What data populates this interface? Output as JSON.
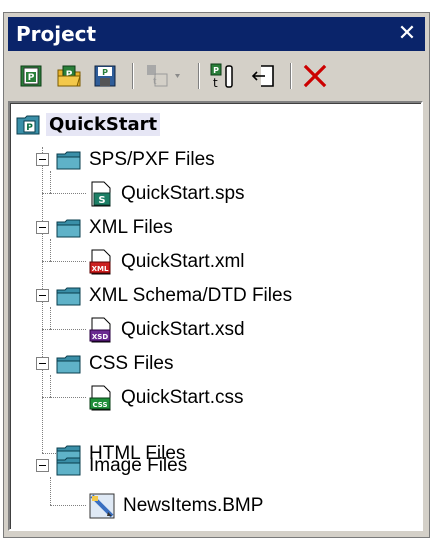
{
  "panel": {
    "title": "Project",
    "close_glyph": "✕"
  },
  "toolbar": {
    "buttons": [
      {
        "name": "new-project-icon"
      },
      {
        "name": "open-project-icon"
      },
      {
        "name": "save-project-icon"
      },
      {
        "name": "add-files-dropdown-icon"
      },
      {
        "name": "add-active-file-icon"
      },
      {
        "name": "add-url-icon"
      },
      {
        "name": "delete-icon"
      }
    ]
  },
  "tree": {
    "root": {
      "label": "QuickStart"
    },
    "folders": [
      {
        "label": "SPS/PXF Files",
        "file": "QuickStart.sps",
        "file_icon": "sps-file-icon",
        "badge": "S"
      },
      {
        "label": "XML Files",
        "file": "QuickStart.xml",
        "file_icon": "xml-file-icon",
        "badge": "XML"
      },
      {
        "label": "XML Schema/DTD Files",
        "file": "QuickStart.xsd",
        "file_icon": "xsd-file-icon",
        "badge": "XSD"
      },
      {
        "label": "CSS Files",
        "file": "QuickStart.css",
        "file_icon": "css-file-icon",
        "badge": "CSS"
      },
      {
        "label": "HTML Files"
      },
      {
        "label": "Image Files",
        "file": "NewsItems.BMP",
        "file_icon": "bmp-image-icon"
      }
    ]
  },
  "colors": {
    "titlebar": "#0a246a",
    "folder": "#3a8fa8",
    "delete": "#cc0000"
  }
}
